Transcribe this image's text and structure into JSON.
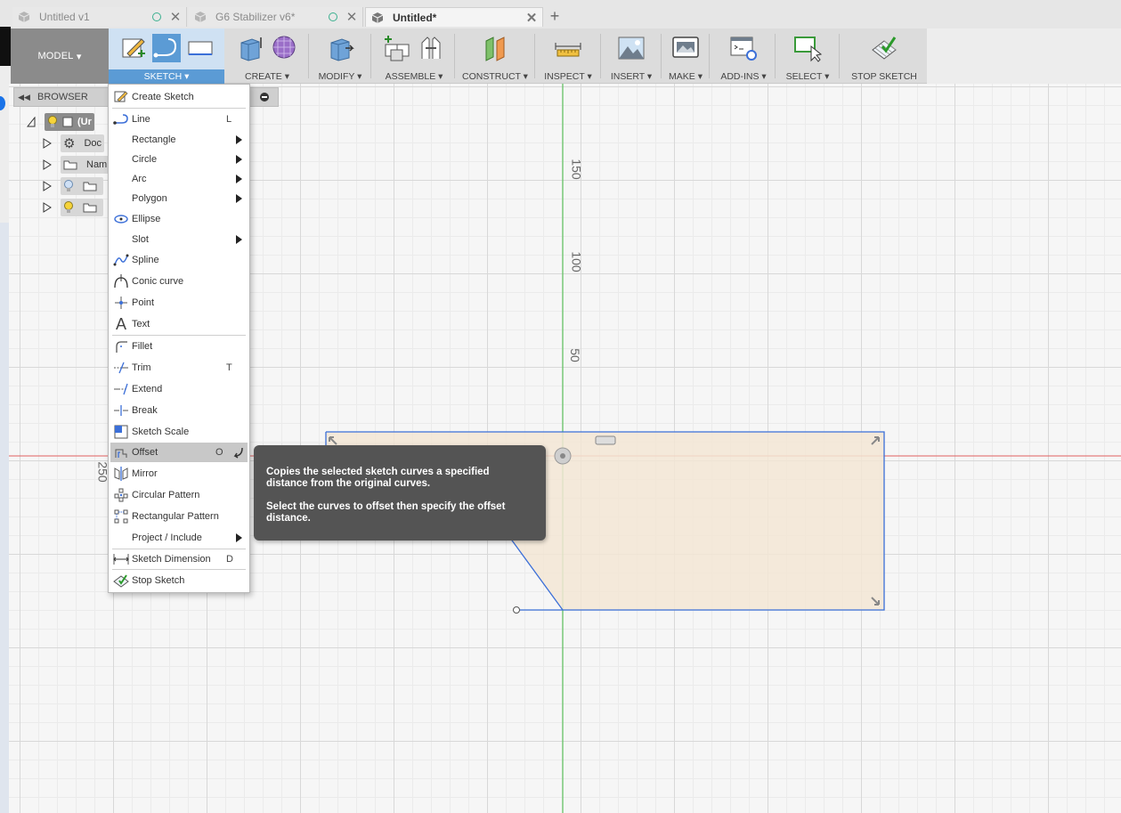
{
  "tabs": [
    {
      "label": "Untitled v1",
      "active": false
    },
    {
      "label": "G6 Stabilizer v6*",
      "active": false
    },
    {
      "label": "Untitled*",
      "active": true
    }
  ],
  "toolbar": {
    "workspace": "MODEL",
    "groups": [
      "SKETCH",
      "CREATE",
      "MODIFY",
      "ASSEMBLE",
      "CONSTRUCT",
      "INSPECT",
      "INSERT",
      "MAKE",
      "ADD-INS",
      "SELECT",
      "STOP SKETCH"
    ]
  },
  "browser": {
    "title": "BROWSER",
    "items": [
      "(Ur",
      "Doc",
      "Nam",
      "",
      ""
    ]
  },
  "sketch_menu": {
    "items": [
      {
        "label": "Create Sketch",
        "shortcut": "",
        "submenu": false,
        "icon": "create-sketch-icon"
      },
      {
        "label": "Line",
        "shortcut": "L",
        "submenu": false,
        "icon": "line-icon"
      },
      {
        "label": "Rectangle",
        "shortcut": "",
        "submenu": true,
        "icon": ""
      },
      {
        "label": "Circle",
        "shortcut": "",
        "submenu": true,
        "icon": ""
      },
      {
        "label": "Arc",
        "shortcut": "",
        "submenu": true,
        "icon": ""
      },
      {
        "label": "Polygon",
        "shortcut": "",
        "submenu": true,
        "icon": ""
      },
      {
        "label": "Ellipse",
        "shortcut": "",
        "submenu": false,
        "icon": "ellipse-icon"
      },
      {
        "label": "Slot",
        "shortcut": "",
        "submenu": true,
        "icon": ""
      },
      {
        "label": "Spline",
        "shortcut": "",
        "submenu": false,
        "icon": "spline-icon"
      },
      {
        "label": "Conic curve",
        "shortcut": "",
        "submenu": false,
        "icon": "conic-curve-icon"
      },
      {
        "label": "Point",
        "shortcut": "",
        "submenu": false,
        "icon": "point-icon"
      },
      {
        "label": "Text",
        "shortcut": "",
        "submenu": false,
        "icon": "text-icon"
      },
      {
        "label": "Fillet",
        "shortcut": "",
        "submenu": false,
        "icon": "fillet-icon"
      },
      {
        "label": "Trim",
        "shortcut": "T",
        "submenu": false,
        "icon": "trim-icon"
      },
      {
        "label": "Extend",
        "shortcut": "",
        "submenu": false,
        "icon": "extend-icon"
      },
      {
        "label": "Break",
        "shortcut": "",
        "submenu": false,
        "icon": "break-icon"
      },
      {
        "label": "Sketch Scale",
        "shortcut": "",
        "submenu": false,
        "icon": "sketch-scale-icon"
      },
      {
        "label": "Offset",
        "shortcut": "O",
        "submenu": false,
        "icon": "offset-icon",
        "highlighted": true
      },
      {
        "label": "Mirror",
        "shortcut": "",
        "submenu": false,
        "icon": "mirror-icon"
      },
      {
        "label": "Circular Pattern",
        "shortcut": "",
        "submenu": false,
        "icon": "circular-pattern-icon"
      },
      {
        "label": "Rectangular Pattern",
        "shortcut": "",
        "submenu": false,
        "icon": "rectangular-pattern-icon"
      },
      {
        "label": "Project / Include",
        "shortcut": "",
        "submenu": true,
        "icon": ""
      },
      {
        "label": "Sketch Dimension",
        "shortcut": "D",
        "submenu": false,
        "icon": "sketch-dimension-icon"
      },
      {
        "label": "Stop Sketch",
        "shortcut": "",
        "submenu": false,
        "icon": "stop-sketch-icon"
      }
    ]
  },
  "tooltip": {
    "line1": "Copies the selected sketch curves a specified distance from the original curves.",
    "line2": "Select the curves to offset then specify the offset distance."
  },
  "axis_labels": {
    "y150": "150",
    "y100": "100",
    "y50": "50",
    "x250": "250"
  },
  "colors": {
    "accent": "#5b9bd5",
    "sketch_line": "#3b6fd8",
    "profile_fill": "#f3e6d5",
    "x_axis": "#e06060",
    "y_axis": "#5cc05c"
  }
}
